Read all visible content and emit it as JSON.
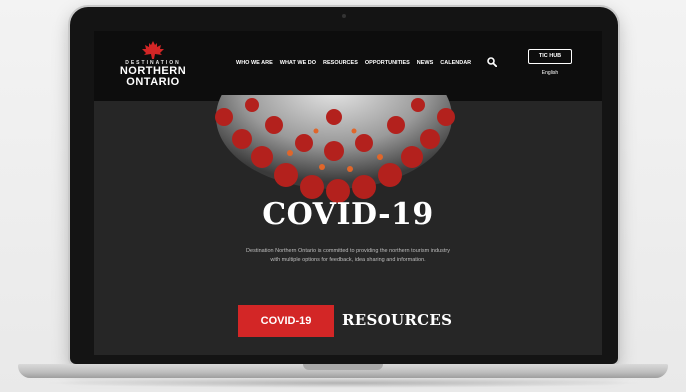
{
  "header": {
    "logo": {
      "small": "DESTINATION",
      "line1": "NORTHERN",
      "line2": "ONTARIO"
    },
    "nav": [
      {
        "label": "WHO WE ARE"
      },
      {
        "label": "WHAT WE DO"
      },
      {
        "label": "RESOURCES"
      },
      {
        "label": "OPPORTUNITIES"
      },
      {
        "label": "NEWS"
      },
      {
        "label": "CALENDAR"
      }
    ],
    "tic_hub": "TIC HUB",
    "language": "English"
  },
  "hero": {
    "title": "COVID-19",
    "description": "Destination Northern Ontario is committed to providing the northern tourism industry with multiple options for feedback, idea sharing and information.",
    "button_label": "COVID-19",
    "resources_label": "RESOURCES"
  },
  "colors": {
    "accent_red": "#d32626",
    "header_bg": "#0d0d0d",
    "hero_bg": "#262626"
  },
  "icons": [
    "maple-leaf-icon",
    "search-icon"
  ]
}
